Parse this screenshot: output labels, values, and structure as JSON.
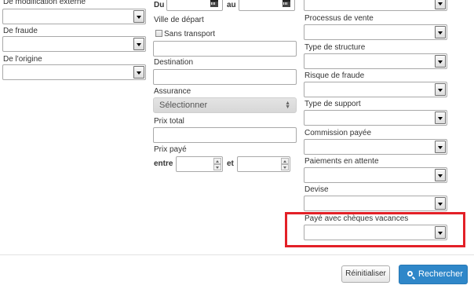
{
  "left": {
    "modification_label": "De modification externe",
    "fraude_label": "De fraude",
    "origine_label": "De l'origine"
  },
  "middle": {
    "du_label": "Du",
    "au_label": "au",
    "ville_depart_label": "Ville de départ",
    "sans_transport_label": "Sans transport",
    "destination_label": "Destination",
    "assurance_label": "Assurance",
    "assurance_value": "Sélectionner",
    "prix_total_label": "Prix total",
    "prix_paye_label": "Prix payé",
    "entre_label": "entre",
    "et_label": "et"
  },
  "right": {
    "processus_vente_label": "Processus de vente",
    "type_structure_label": "Type de structure",
    "risque_fraude_label": "Risque de fraude",
    "type_support_label": "Type de support",
    "commission_label": "Commission payée",
    "paiements_attente_label": "Paiements en attente",
    "devise_label": "Devise",
    "cheques_vacances_label": "Payé avec chèques vacances"
  },
  "footer": {
    "reset_label": "Réinitialiser",
    "search_label": "Rechercher"
  },
  "colors": {
    "highlight": "#e32027",
    "primary_button": "#2f87c9"
  },
  "icons": {
    "calendar": "calendar-icon",
    "dropdown": "chevron-down-icon",
    "search": "search-icon"
  }
}
